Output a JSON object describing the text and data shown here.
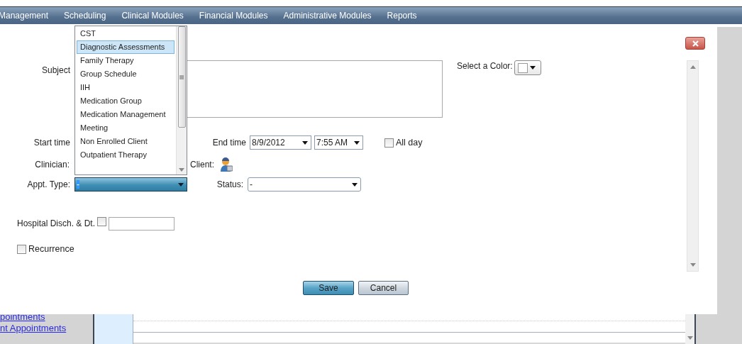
{
  "nav": {
    "items": [
      "Management",
      "Scheduling",
      "Clinical Modules",
      "Financial Modules",
      "Administrative Modules",
      "Reports"
    ]
  },
  "dialog": {
    "subject": {
      "label": "Subject"
    },
    "color_picker": {
      "label": "Select a Color:"
    },
    "start_time": {
      "label": "Start time"
    },
    "end_time": {
      "label": "End time",
      "date": "8/9/2012",
      "time": "7:55 AM"
    },
    "all_day": {
      "label": "All day",
      "checked": false
    },
    "clinician": {
      "label": "Clinician:"
    },
    "client": {
      "label": "Client:"
    },
    "appt_type": {
      "label": "Appt. Type:",
      "value": "-",
      "expanded": true,
      "options": [
        {
          "label": "CST",
          "selected": false
        },
        {
          "label": "Diagnostic Assessments",
          "selected": true
        },
        {
          "label": "Family Therapy",
          "selected": false
        },
        {
          "label": "Group Schedule",
          "selected": false
        },
        {
          "label": "IIH",
          "selected": false
        },
        {
          "label": "Medication Group",
          "selected": false
        },
        {
          "label": "Medication Management",
          "selected": false
        },
        {
          "label": "Meeting",
          "selected": false
        },
        {
          "label": "Non Enrolled Client",
          "selected": false
        },
        {
          "label": "Outpatient Therapy",
          "selected": false
        }
      ]
    },
    "status": {
      "label": "Status:",
      "value": "-"
    },
    "hospital_discharge": {
      "label": "Hospital Disch. & Dt.",
      "checked": false
    },
    "recurrence": {
      "label": "Recurrence",
      "checked": false
    },
    "buttons": [
      {
        "label": "Save",
        "kind": "primary"
      },
      {
        "label": "Cancel",
        "kind": "secondary"
      }
    ]
  },
  "background": {
    "links": [
      "pointments",
      "nt Appointments"
    ]
  }
}
